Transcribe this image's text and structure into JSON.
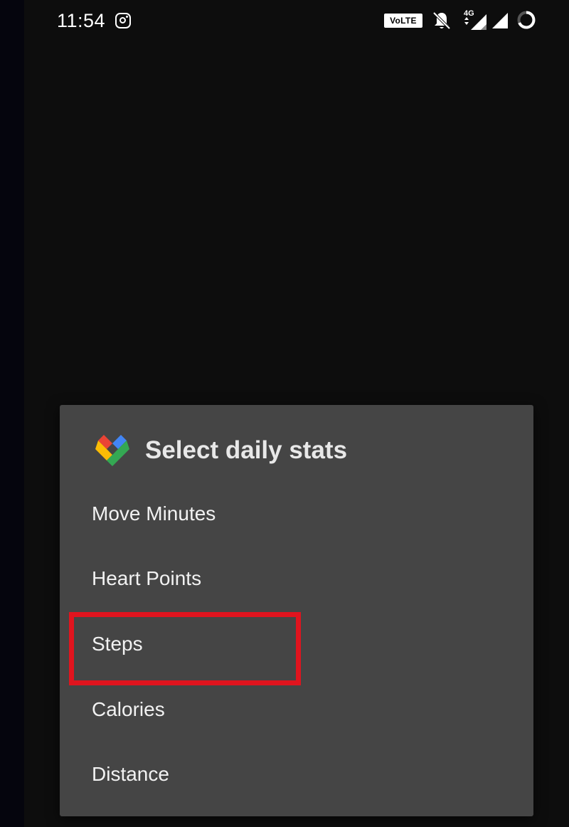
{
  "status_bar": {
    "time": "11:54",
    "notification_icons": [
      "instagram-icon"
    ],
    "volte_label": "VoLTE",
    "network_type": "4G",
    "system_icons": [
      "volte-badge",
      "bell-off-icon",
      "signal-4g-icon",
      "signal-icon",
      "battery-ring-icon"
    ]
  },
  "dialog": {
    "app_icon": "google-fit-heart-icon",
    "title": "Select daily stats",
    "options": [
      {
        "label": "Move Minutes"
      },
      {
        "label": "Heart Points"
      },
      {
        "label": "Steps",
        "highlighted": true
      },
      {
        "label": "Calories"
      },
      {
        "label": "Distance"
      }
    ]
  },
  "colors": {
    "background": "#0d0d0d",
    "dialog_bg": "#454545",
    "text": "#f2f2f2",
    "highlight": "#e0141e",
    "logo_blue": "#4285f4",
    "logo_red": "#ea4335",
    "logo_yellow": "#fbbc05",
    "logo_green": "#34a853"
  }
}
